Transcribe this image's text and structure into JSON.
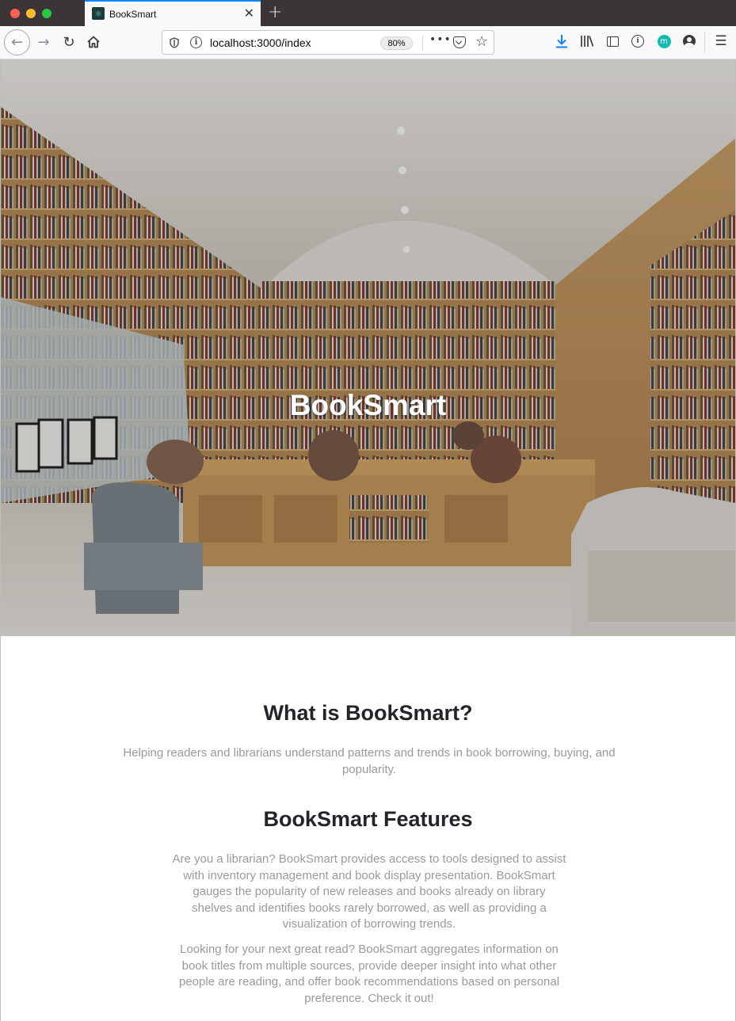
{
  "browser": {
    "tab_title": "BookSmart",
    "new_tab_symbol": "+",
    "url_host": "localhost",
    "url_rest": ":3000/index",
    "zoom": "80%"
  },
  "icons": {
    "tab_favicon": "react-atom-icon",
    "back": "back-arrow-icon",
    "forward": "forward-arrow-icon",
    "reload": "reload-icon",
    "home": "home-icon",
    "download": "download-icon",
    "library": "library-icon",
    "sidebar": "sidebar-icon",
    "account": "account-icon",
    "menu": "hamburger-menu-icon"
  },
  "hero": {
    "title": "BookSmart"
  },
  "sections": {
    "what_title": "What is BookSmart?",
    "what_text": "Helping readers and librarians understand patterns and trends in book borrowing, buying, and popularity.",
    "features_title": "BookSmart Features",
    "features_p1": "Are you a librarian? BookSmart provides access to tools designed to assist with inventory management and book display presentation. BookSmart gauges the popularity of new releases and books already on library shelves and identifies books rarely borrowed, as well as providing a visualization of borrowing trends.",
    "features_p2": "Looking for your next great read? BookSmart aggregates information on book titles from multiple sources, provide deeper insight into what other people are reading, and offer book recommendations based on personal preference. Check it out!"
  },
  "colors": {
    "tab_accent": "#0a84ff",
    "heading": "#212529",
    "body_text": "#9a9a9a",
    "titlebar": "#3b3537"
  }
}
